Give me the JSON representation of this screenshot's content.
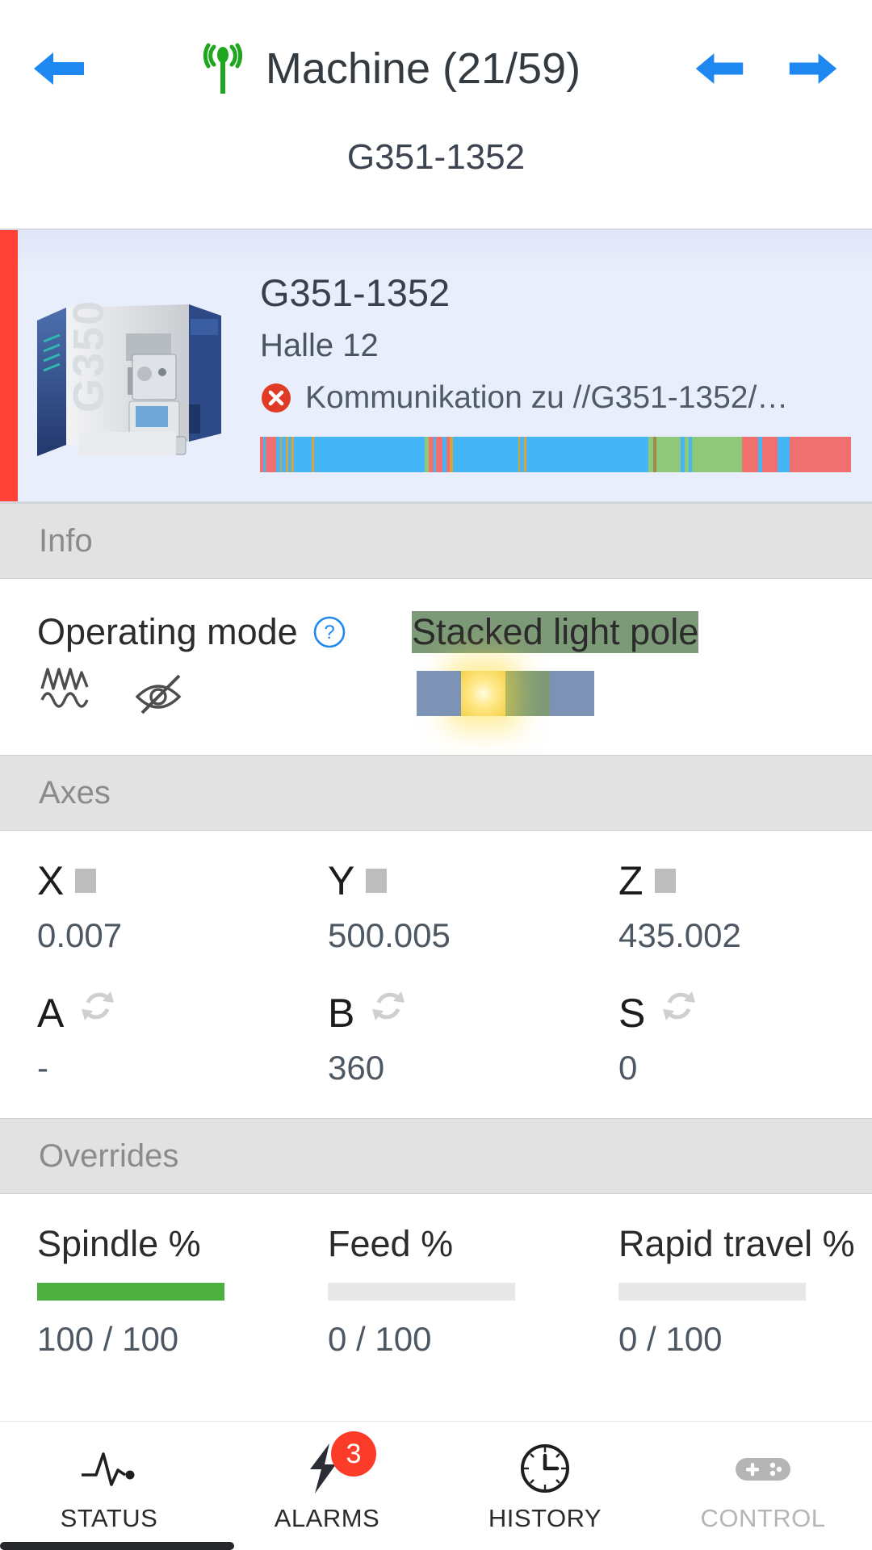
{
  "header": {
    "back_icon": "arrow-left-icon",
    "status_icon": "antenna-signal-icon",
    "title": "Machine (21/59)",
    "prev_icon": "arrow-left-icon",
    "next_icon": "arrow-right-icon",
    "subtitle": "G351-1352",
    "accent_blue": "#1e88f0"
  },
  "machine_card": {
    "status_color": "#ff4136",
    "name": "G351-1352",
    "location": "Halle 12",
    "alert_icon": "error-circle-icon",
    "alert_text": "Kommunikation zu //G351-1352/…",
    "thumbnail_label": "G350",
    "timeline": {
      "segments": [
        {
          "color": "#f07070",
          "w": 0.4
        },
        {
          "color": "#45b6f5",
          "w": 0.3
        },
        {
          "color": "#f07070",
          "w": 1.4
        },
        {
          "color": "#45b6f5",
          "w": 0.5
        },
        {
          "color": "#d8a33a",
          "w": 0.3
        },
        {
          "color": "#45b6f5",
          "w": 0.5
        },
        {
          "color": "#d8a33a",
          "w": 0.3
        },
        {
          "color": "#45b6f5",
          "w": 0.4
        },
        {
          "color": "#d8a33a",
          "w": 0.3
        },
        {
          "color": "#45b6f5",
          "w": 2.4
        },
        {
          "color": "#d8a33a",
          "w": 0.3
        },
        {
          "color": "#45b6f5",
          "w": 14.5
        },
        {
          "color": "#8fc87a",
          "w": 0.5
        },
        {
          "color": "#f07070",
          "w": 0.6
        },
        {
          "color": "#45b6f5",
          "w": 0.4
        },
        {
          "color": "#f07070",
          "w": 0.8
        },
        {
          "color": "#45b6f5",
          "w": 0.5
        },
        {
          "color": "#f07070",
          "w": 0.5
        },
        {
          "color": "#d8a33a",
          "w": 0.4
        },
        {
          "color": "#45b6f5",
          "w": 8.5
        },
        {
          "color": "#d8a33a",
          "w": 0.3
        },
        {
          "color": "#45b6f5",
          "w": 0.5
        },
        {
          "color": "#d8a33a",
          "w": 0.3
        },
        {
          "color": "#45b6f5",
          "w": 16.0
        },
        {
          "color": "#8fc87a",
          "w": 0.6
        },
        {
          "color": "#a08a4a",
          "w": 0.4
        },
        {
          "color": "#8fc87a",
          "w": 3.2
        },
        {
          "color": "#45b6f5",
          "w": 0.5
        },
        {
          "color": "#8fc87a",
          "w": 0.6
        },
        {
          "color": "#45b6f5",
          "w": 0.4
        },
        {
          "color": "#8fc87a",
          "w": 6.5
        },
        {
          "color": "#f07070",
          "w": 2.2
        },
        {
          "color": "#45b6f5",
          "w": 0.5
        },
        {
          "color": "#f07070",
          "w": 2.0
        },
        {
          "color": "#45b6f5",
          "w": 1.6
        },
        {
          "color": "#f07070",
          "w": 8.0
        }
      ]
    }
  },
  "sections": {
    "info": "Info",
    "axes": "Axes",
    "overrides": "Overrides"
  },
  "info": {
    "operating_mode_label": "Operating mode",
    "help_icon": "help-circle-icon",
    "mode_icons": [
      "waveform-zigzag-icon",
      "eye-slash-icon"
    ],
    "light_pole_label": "Stacked light pole",
    "lights": [
      {
        "name": "red",
        "color": "#f05252",
        "on": true
      },
      {
        "name": "yellow",
        "color": "#f5d14a",
        "on": true
      },
      {
        "name": "green",
        "color": "#7d9a78",
        "on": false
      },
      {
        "name": "blue",
        "color": "#7d93b5",
        "on": false
      }
    ]
  },
  "axes": {
    "row1": [
      {
        "name": "X",
        "indicator": "square-icon",
        "value": "0.007"
      },
      {
        "name": "Y",
        "indicator": "square-icon",
        "value": "500.005"
      },
      {
        "name": "Z",
        "indicator": "square-icon",
        "value": "435.002"
      }
    ],
    "row2": [
      {
        "name": "A",
        "indicator": "refresh-icon",
        "value": "-"
      },
      {
        "name": "B",
        "indicator": "refresh-icon",
        "value": "360"
      },
      {
        "name": "S",
        "indicator": "refresh-icon",
        "value": "0"
      }
    ]
  },
  "overrides": {
    "items": [
      {
        "label": "Spindle %",
        "value": "100 / 100",
        "percent": 100,
        "bar_color": "#4caf3f"
      },
      {
        "label": "Feed %",
        "value": "0 / 100",
        "percent": 0,
        "bar_color": "#4caf3f"
      },
      {
        "label": "Rapid travel %",
        "value": "0 / 100",
        "percent": 0,
        "bar_color": "#4caf3f"
      }
    ]
  },
  "bottom_nav": {
    "items": [
      {
        "label": "STATUS",
        "icon": "pulse-icon",
        "badge": null,
        "active": true,
        "disabled": false
      },
      {
        "label": "ALARMS",
        "icon": "lightning-icon",
        "badge": "3",
        "active": false,
        "disabled": false
      },
      {
        "label": "HISTORY",
        "icon": "clock-icon",
        "badge": null,
        "active": false,
        "disabled": false
      },
      {
        "label": "CONTROL",
        "icon": "gamepad-icon",
        "badge": null,
        "active": false,
        "disabled": true
      }
    ]
  }
}
